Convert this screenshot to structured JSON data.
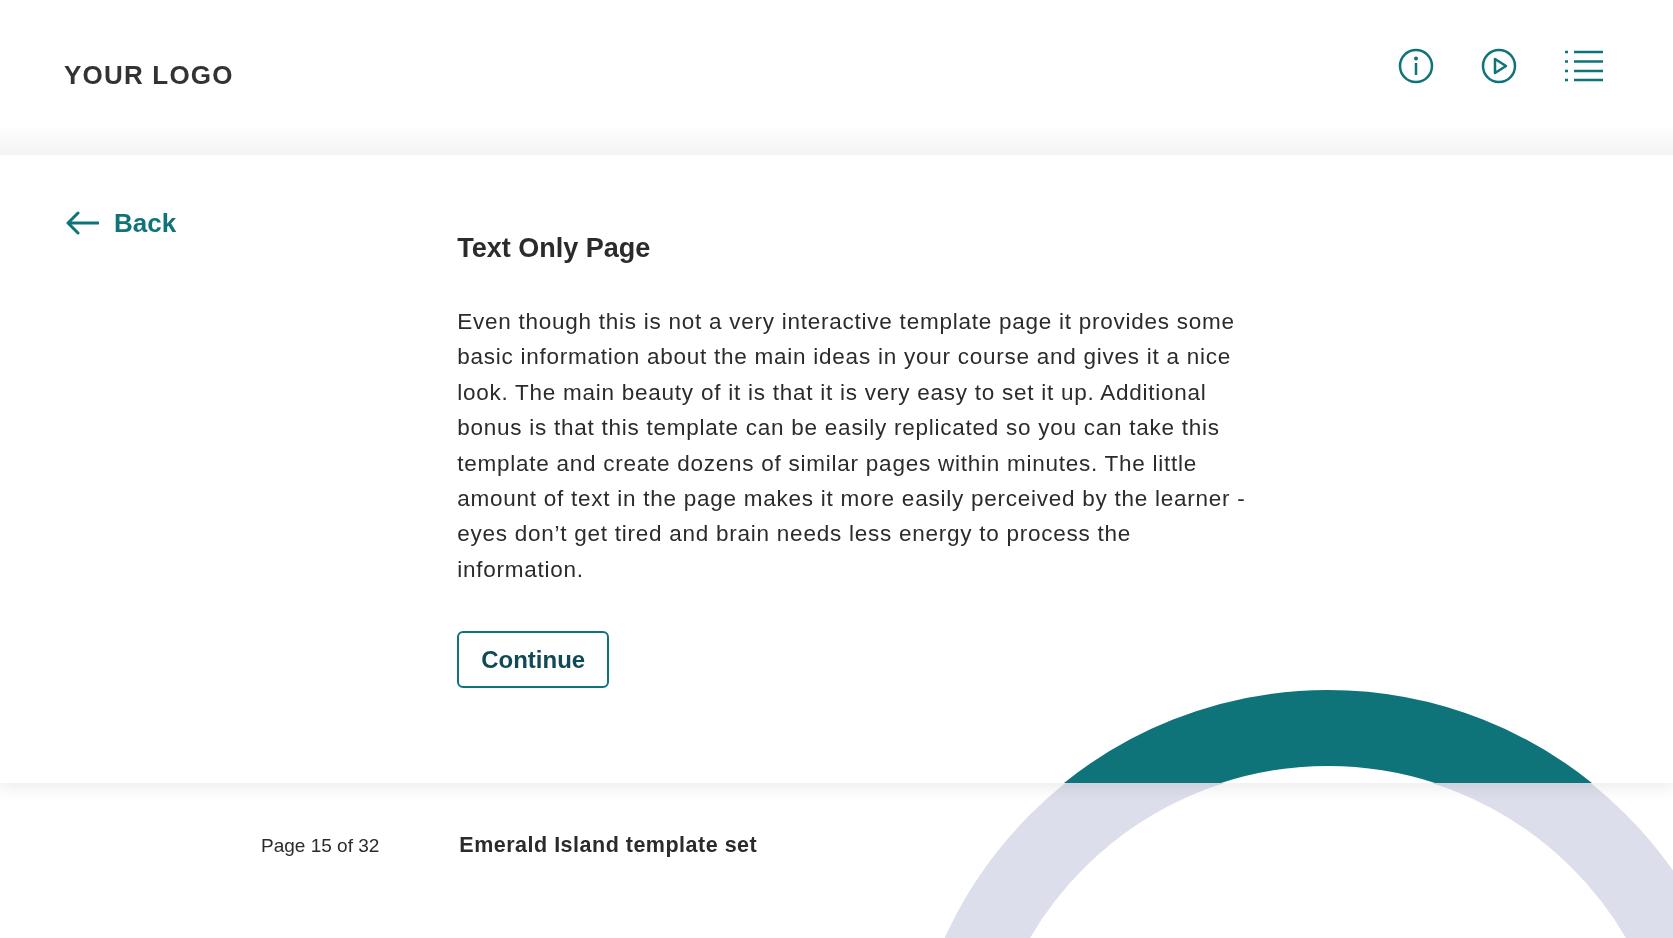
{
  "header": {
    "logo": "YOUR LOGO"
  },
  "back": {
    "label": "Back"
  },
  "content": {
    "title": "Text Only Page",
    "paragraph": "Even though this is not a very interactive template page it provides some basic information about the main ideas in your course and gives it a nice look. The main beauty of it is that it is very easy to set it up. Additional bonus is that this template can be easily replicated so you can take this template and create dozens of similar pages within minutes. The little amount of text in the page makes it more easily perceived by the learner - eyes don’t get tired and brain needs less energy to process the information.",
    "button": "Continue"
  },
  "footer": {
    "page": "Page 15 of 32",
    "course_title": "Emerald Island template set"
  }
}
